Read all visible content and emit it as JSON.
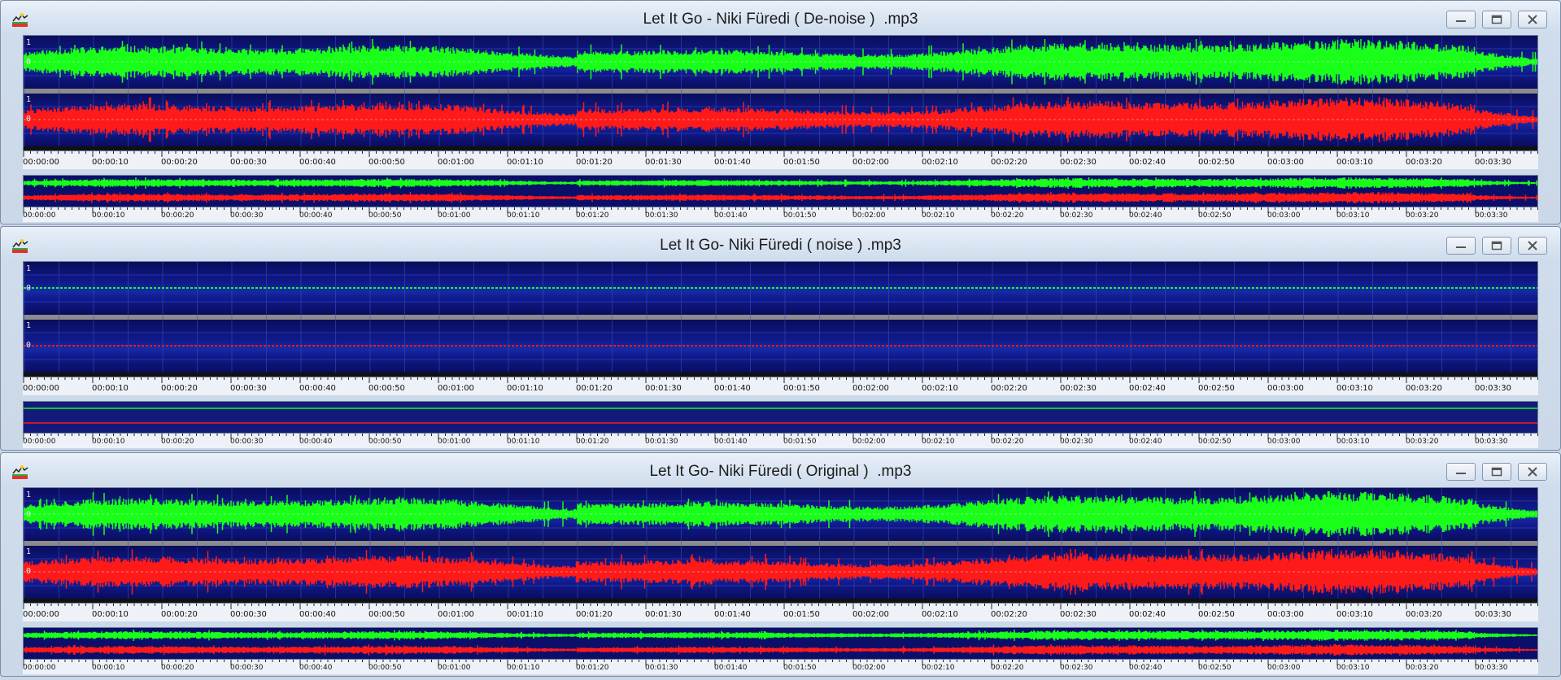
{
  "windows": [
    {
      "title": "Let It Go - Niki Füredi ( De-noise )  .mp3",
      "variant": "music",
      "seed": 11
    },
    {
      "title": "Let It Go- Niki Füredi ( noise ) .mp3",
      "variant": "noise",
      "seed": 23
    },
    {
      "title": "Let It Go- Niki Füredi ( Original )  .mp3",
      "variant": "music",
      "seed": 37
    }
  ],
  "channel_scale": {
    "top": "1",
    "zero": "0"
  },
  "timeline": [
    "00:00:00",
    "00:00:10",
    "00:00:20",
    "00:00:30",
    "00:00:40",
    "00:00:50",
    "00:01:00",
    "00:01:10",
    "00:01:20",
    "00:01:30",
    "00:01:40",
    "00:01:50",
    "00:02:00",
    "00:02:10",
    "00:02:20",
    "00:02:30",
    "00:02:40",
    "00:02:50",
    "00:03:00",
    "00:03:10",
    "00:03:20",
    "00:03:30"
  ],
  "icons": {
    "app": "waveform-app-icon",
    "minimize": "minimize-icon",
    "maximize": "maximize-icon",
    "close": "close-icon"
  },
  "colors": {
    "left_channel": "#19ff19",
    "right_channel": "#ff1a1a",
    "background": "#0b0f6a",
    "grid": "#3a4fb8"
  }
}
